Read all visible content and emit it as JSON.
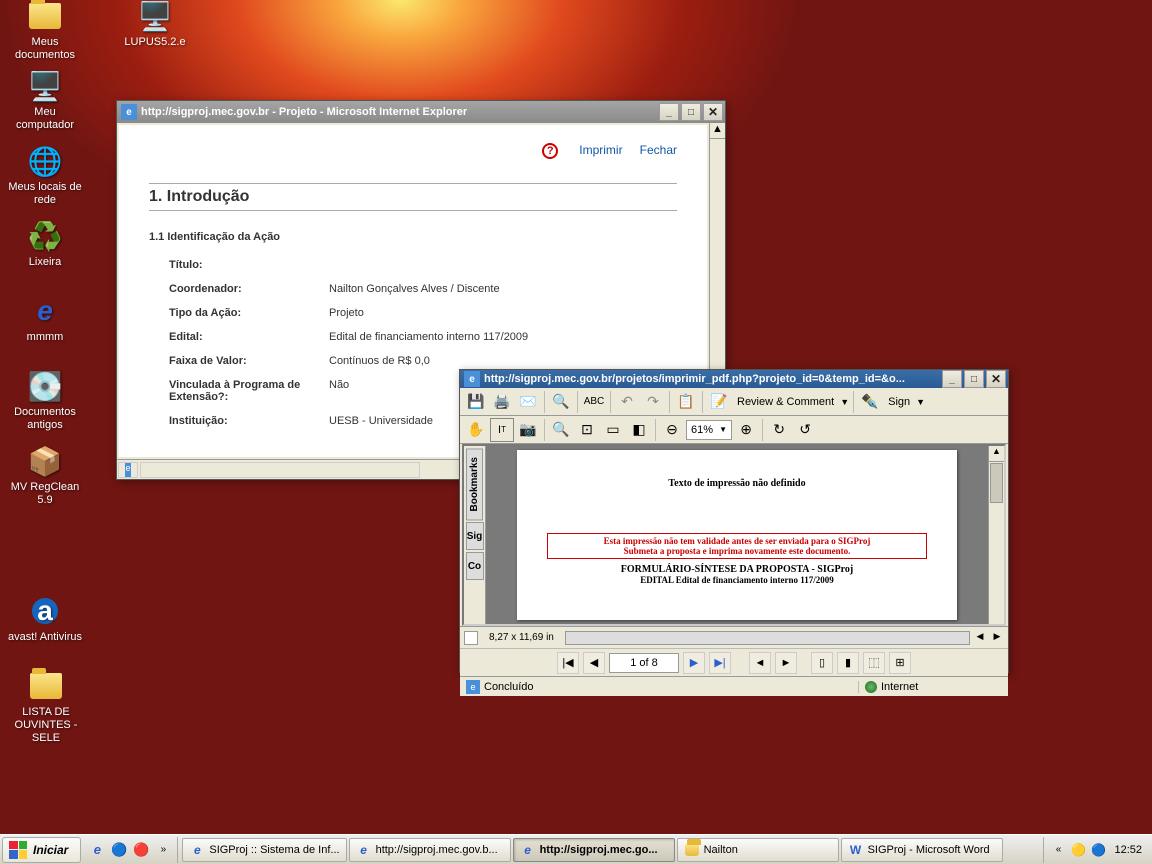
{
  "desktop": {
    "icons": [
      {
        "name": "Meus documentos"
      },
      {
        "name": "LUPUS5.2.e"
      },
      {
        "name": "Meu computador"
      },
      {
        "name": "Meus locais de rede"
      },
      {
        "name": "Lixeira"
      },
      {
        "name": "mmmm"
      },
      {
        "name": "Documentos antigos"
      },
      {
        "name": "MV RegClean 5.9"
      },
      {
        "name": "avast! Antivirus"
      },
      {
        "name": "LISTA DE OUVINTES - SELE"
      }
    ]
  },
  "window1": {
    "title": "http://sigproj.mec.gov.br - Projeto - Microsoft Internet Explorer",
    "actions": {
      "print": "Imprimir",
      "close": "Fechar"
    },
    "section": "1. Introdução",
    "subsection": "1.1 Identificação da Ação",
    "fields": [
      {
        "k": "Título:",
        "v": ""
      },
      {
        "k": "Coordenador:",
        "v": "Nailton Gonçalves Alves / Discente"
      },
      {
        "k": "Tipo da Ação:",
        "v": "Projeto"
      },
      {
        "k": "Edital:",
        "v": "Edital de financiamento interno 117/2009"
      },
      {
        "k": "Faixa de Valor:",
        "v": "Contínuos de R$ 0,0"
      },
      {
        "k": "Vinculada à Programa de Extensão?:",
        "v": "Não"
      },
      {
        "k": "Instituição:",
        "v": "UESB - Universidade"
      }
    ]
  },
  "window2": {
    "title": "http://sigproj.mec.gov.br/projetos/imprimir_pdf.php?projeto_id=0&temp_id=&o...",
    "review_label": "Review & Comment",
    "sign_label": "Sign",
    "zoom": "61%",
    "bookmarks_tab": "Bookmarks",
    "sig_tab": "Sig",
    "page_msg": "Texto de impressão não definido",
    "warn1": "Esta impressão não tem validade antes de ser enviada para o SIGProj",
    "warn2": "Submeta a proposta e imprima novamente este documento.",
    "form_title": "FORMULÁRIO-SÍNTESE DA PROPOSTA - SIGProj",
    "form_sub": "EDITAL Edital de financiamento interno 117/2009",
    "dims": "8,27 x 11,69 in",
    "page_display": "1 of 8",
    "status": "Concluído",
    "zone": "Internet"
  },
  "taskbar": {
    "start": "Iniciar",
    "tasks": [
      {
        "label": "SIGProj :: Sistema de Inf..."
      },
      {
        "label": "http://sigproj.mec.gov.b..."
      },
      {
        "label": "http://sigproj.mec.go...",
        "active": true
      },
      {
        "label": "Nailton"
      },
      {
        "label": "SIGProj - Microsoft Word"
      }
    ],
    "clock": "12:52"
  }
}
